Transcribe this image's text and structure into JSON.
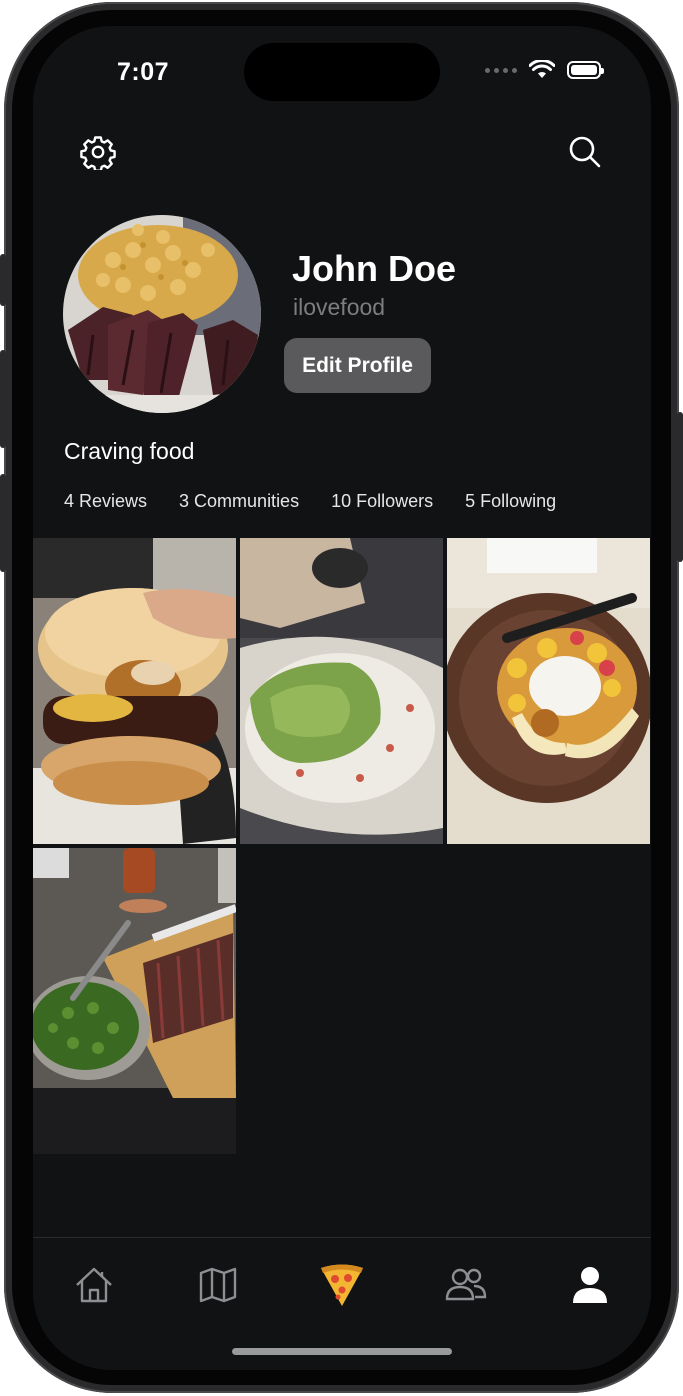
{
  "status_bar": {
    "time": "7:07"
  },
  "header": {
    "settings_icon": "gear-icon",
    "search_icon": "search-icon"
  },
  "profile": {
    "display_name": "John Doe",
    "username": "ilovefood",
    "edit_button_label": "Edit Profile",
    "bio": "Craving food",
    "stats": {
      "reviews": "4 Reviews",
      "communities": "3 Communities",
      "followers": "10 Followers",
      "following": "5 Following"
    }
  },
  "posts": [
    {
      "subject": "burger"
    },
    {
      "subject": "guacamole bowl"
    },
    {
      "subject": "waffle with ice cream and fruit"
    },
    {
      "subject": "sliced steak with chimichurri"
    }
  ],
  "tab_bar": {
    "items": [
      {
        "icon": "home-icon"
      },
      {
        "icon": "map-icon"
      },
      {
        "icon": "pizza-icon"
      },
      {
        "icon": "community-icon"
      },
      {
        "icon": "profile-icon"
      }
    ],
    "active": "profile-icon"
  },
  "colors": {
    "background": "#111214",
    "edit_button": "#5a5a5c",
    "secondary_text": "#7d7d80",
    "accent_pizza": "#f2b632"
  }
}
